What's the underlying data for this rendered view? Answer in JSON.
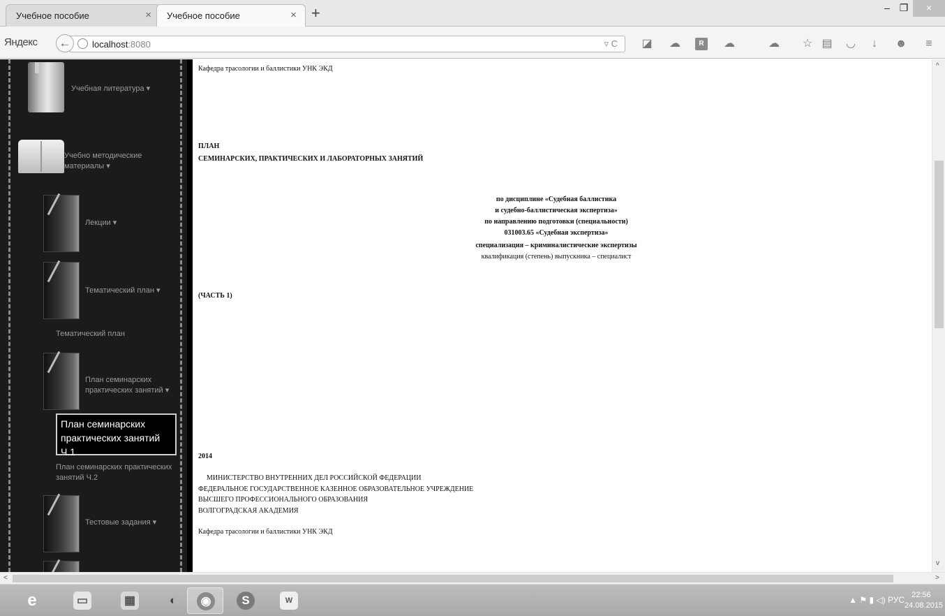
{
  "browser": {
    "tabs": [
      {
        "label": "Учебное пособие",
        "close": "×"
      },
      {
        "label": "Учебное пособие",
        "close": "×"
      }
    ],
    "new_tab": "+",
    "window_controls": {
      "minimize": "–",
      "restore": "❐",
      "close": "×"
    },
    "brand": "Яндекс",
    "back_glyph": "←",
    "url_host": "localhost",
    "url_port": ":8080",
    "url_icons": "▿ C"
  },
  "sidebar": {
    "items": {
      "study_lit": "Учебная литература ▾",
      "method_materials": "Учебно методические материалы ▾",
      "lectures": "Лекции ▾",
      "thematic_plan": "Тематический план ▾",
      "thematic_plan_link": "Тематический план",
      "seminar_plan": "План семинарских практических занятий ▾",
      "seminar_part1": "План семинарских практических занятий Ч.1",
      "seminar_part2": "План семинарских практических занятий Ч.2",
      "tests": "Тестовые задания ▾"
    }
  },
  "document": {
    "dept_top": "Кафедра трасологии и баллистики УНК ЭКД",
    "plan": "ПЛАН",
    "plan_subtitle": "СЕМИНАРСКИХ, ПРАКТИЧЕСКИХ И ЛАБОРАТОРНЫХ ЗАНЯТИЙ",
    "discipline_1": "по дисциплине «Судебная баллистика",
    "discipline_2": "и судебно-баллистическая экспертиза»",
    "direction": "по направлению подготовки (специальности)",
    "code": "031003.65 «Судебная экспертиза»",
    "specialization": "специализация – криминалистические экспертизы",
    "qualification": "квалификация (степень) выпускника – специалист",
    "part": "(ЧАСТЬ 1)",
    "year": "2014",
    "ministry": "МИНИСТЕРСТВО ВНУТРЕННИХ ДЕЛ РОССИЙСКОЙ ФЕДЕРАЦИИ",
    "institution": "ФЕДЕРАЛЬНОЕ ГОСУДАРСТВЕННОЕ КАЗЕННОЕ ОБРАЗОВАТЕЛЬНОЕ УЧРЕЖДЕНИЕ",
    "education": "ВЫСШЕГО ПРОФЕССИОНАЛЬНОГО ОБРАЗОВАНИЯ",
    "academy": "ВОЛГОГРАДСКАЯ АКАДЕМИЯ",
    "dept_bottom": "Кафедра трасологии и баллистики УНК ЭКД"
  },
  "taskbar": {
    "tray_text": "▲  ⚑  ▮  ◁)  РУС",
    "time": "22:56",
    "date": "24.08.2015"
  }
}
